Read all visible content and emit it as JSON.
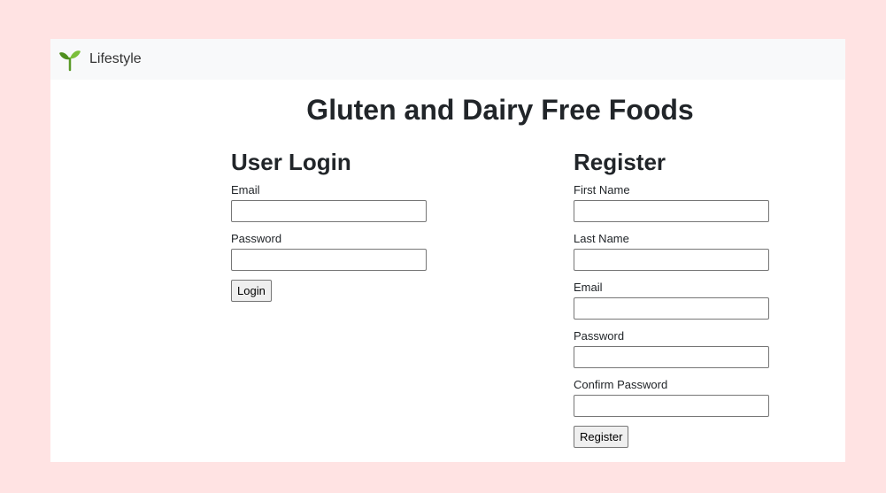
{
  "navbar": {
    "brand": "Lifestyle",
    "icon": "seedling-icon",
    "colors": {
      "leaf_light": "#7bbf3a",
      "leaf_dark": "#4f8f1e",
      "stem": "#5a9a28"
    }
  },
  "heading": "Gluten and Dairy Free Foods",
  "login": {
    "title": "User Login",
    "email_label": "Email",
    "email_value": "",
    "password_label": "Password",
    "password_value": "",
    "button": "Login"
  },
  "register": {
    "title": "Register",
    "first_name_label": "First Name",
    "first_name_value": "",
    "last_name_label": "Last Name",
    "last_name_value": "",
    "email_label": "Email",
    "email_value": "",
    "password_label": "Password",
    "password_value": "",
    "confirm_password_label": "Confirm Password",
    "confirm_password_value": "",
    "button": "Register"
  },
  "colors": {
    "background": "#ffe3e3",
    "navbar": "#f8f9fa",
    "card": "#ffffff"
  }
}
